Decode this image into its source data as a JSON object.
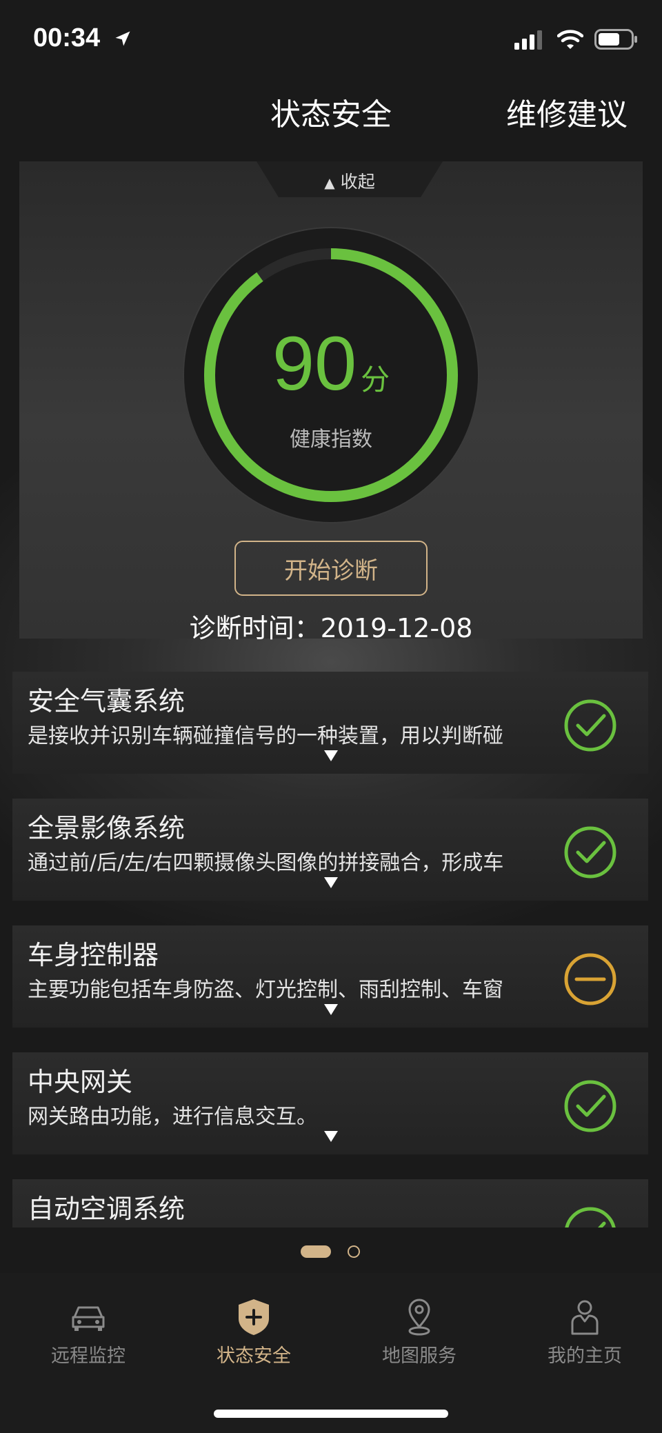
{
  "status_bar": {
    "time": "00:34"
  },
  "header": {
    "title": "状态安全",
    "right_action": "维修建议"
  },
  "score_card": {
    "collapse_label": "收起",
    "score": "90",
    "score_unit": "分",
    "score_fraction": 0.9,
    "score_label": "健康指数",
    "diagnose_button": "开始诊断",
    "diagnose_time": "诊断时间：2019-12-08"
  },
  "systems": [
    {
      "name": "安全气囊系统",
      "desc": "是接收并识别车辆碰撞信号的一种装置，用以判断碰",
      "status": "ok"
    },
    {
      "name": "全景影像系统",
      "desc": "通过前/后/左/右四颗摄像头图像的拼接融合，形成车",
      "status": "ok"
    },
    {
      "name": "车身控制器",
      "desc": "主要功能包括车身防盗、灯光控制、雨刮控制、车窗",
      "status": "warning"
    },
    {
      "name": "中央网关",
      "desc": "网关路由功能，进行信息交互。",
      "status": "ok"
    },
    {
      "name": "自动空调系统",
      "desc": "",
      "status": "ok"
    }
  ],
  "page_indicator": {
    "current": 1,
    "total": 2
  },
  "tabs": [
    {
      "label": "远程监控",
      "icon": "car-icon",
      "active": false
    },
    {
      "label": "状态安全",
      "icon": "shield-plus-icon",
      "active": true
    },
    {
      "label": "地图服务",
      "icon": "map-pin-icon",
      "active": false
    },
    {
      "label": "我的主页",
      "icon": "user-icon",
      "active": false
    }
  ],
  "colors": {
    "accent_gold": "#d2b489",
    "ok_green": "#6ac13f",
    "warn_orange": "#d9a334"
  }
}
